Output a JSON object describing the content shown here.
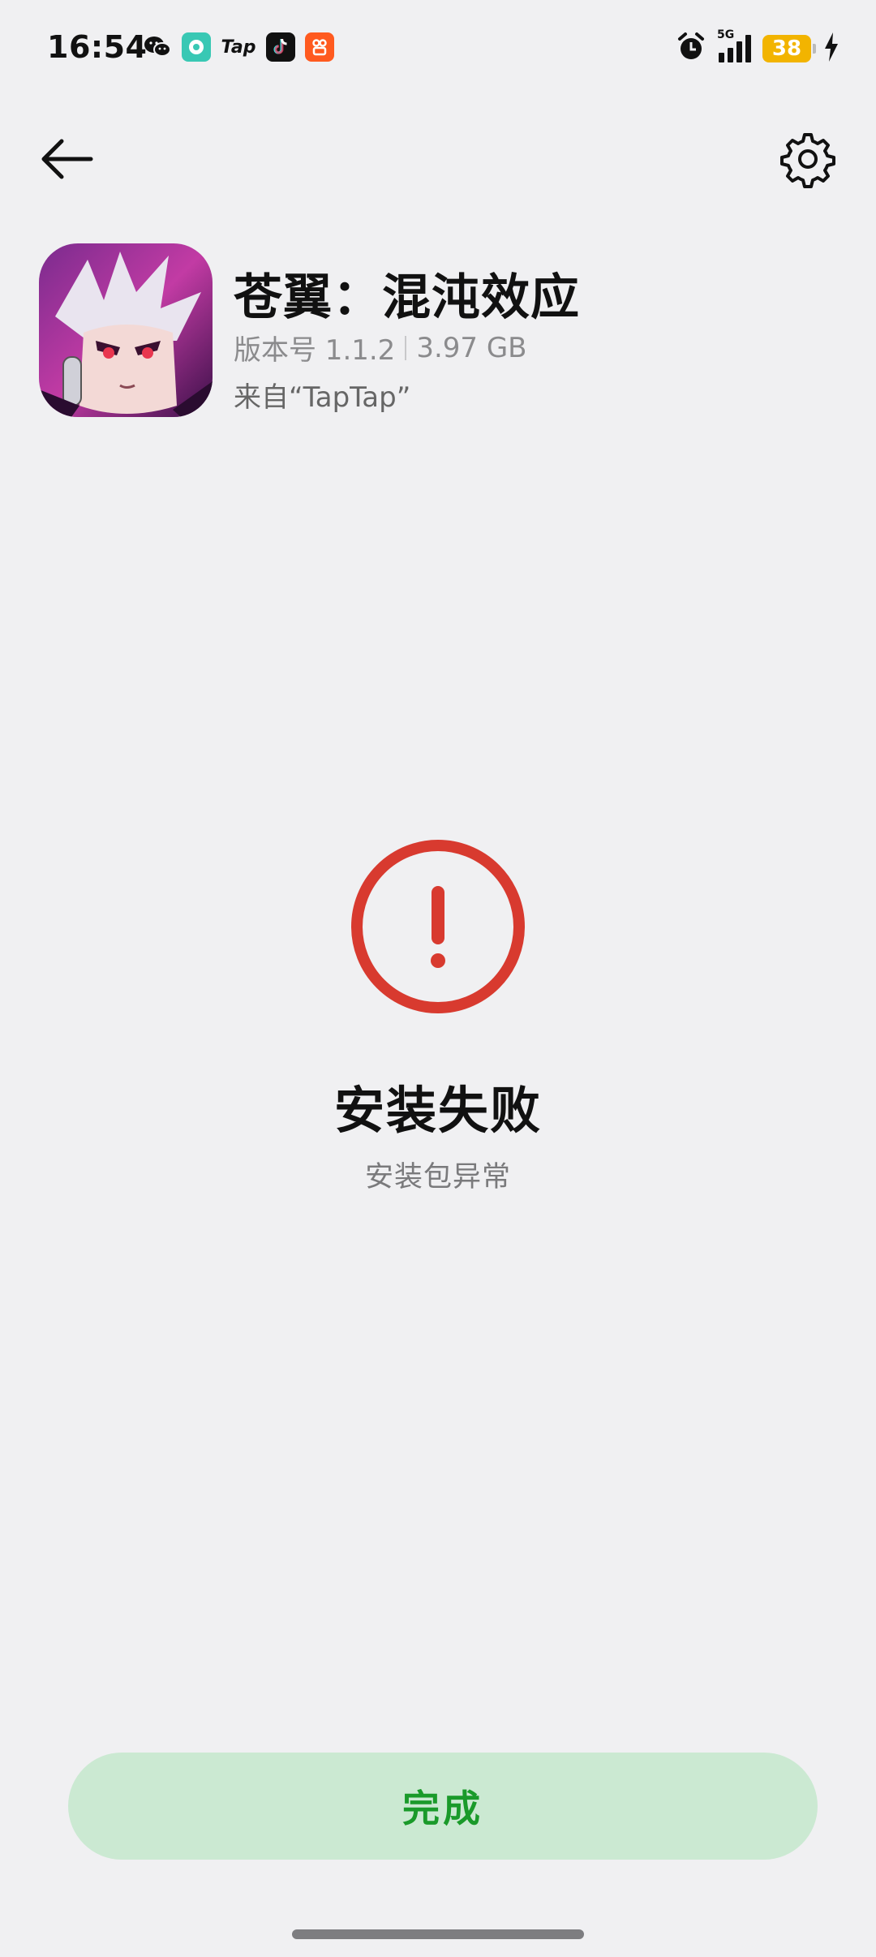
{
  "status_bar": {
    "time": "16:54",
    "network": "5G",
    "battery": "38",
    "notification_icons": [
      "wechat-icon",
      "dou-icon",
      "tap-icon",
      "tiktok-icon",
      "kuaishou-icon"
    ],
    "tap_label": "Tap"
  },
  "app": {
    "name": "苍翼：混沌效应",
    "version": "版本号 1.1.2",
    "size": "3.97 GB",
    "source": "来自“TapTap”"
  },
  "result": {
    "title": "安装失败",
    "reason": "安装包异常",
    "status_color": "#d83a2f"
  },
  "actions": {
    "done_label": "完成",
    "accent_color": "#1a9a2a"
  }
}
